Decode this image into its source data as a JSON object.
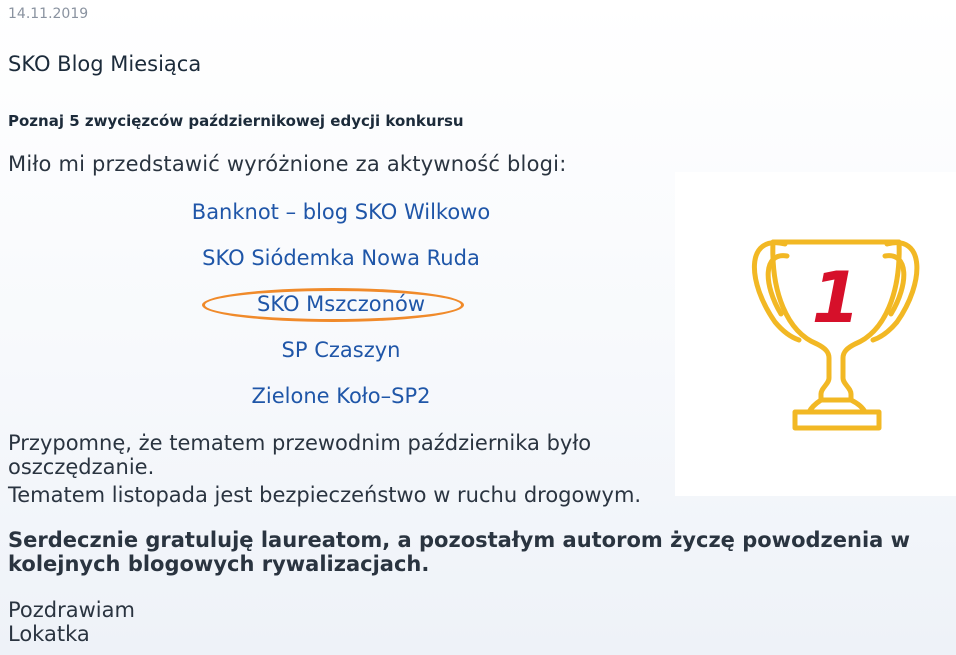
{
  "post": {
    "date": "14.11.2019",
    "title": "SKO Blog Miesiąca",
    "subtitle": "Poznaj 5 zwycięzców październikowej edycji konkursu",
    "intro": "Miło mi przedstawić wyróżnione za aktywność blogi:"
  },
  "winners": [
    {
      "label": "Banknot – blog SKO Wilkowo"
    },
    {
      "label": "SKO Siódemka Nowa Ruda"
    },
    {
      "label": "SKO Mszczonów"
    },
    {
      "label": "SP Czaszyn"
    },
    {
      "label": "Zielone Koło–SP2"
    }
  ],
  "trophy": {
    "number": "1"
  },
  "body": {
    "reminder": "Przypomnę, że tematem przewodnim października było oszczędzanie.",
    "november_topic": "Tematem listopada jest bezpieczeństwo w ruchu drogowym.",
    "congrats": "Serdecznie gratuluję laureatom, a pozostałym autorom życzę powodzenia w kolejnych blogowych rywalizacjach.",
    "greeting": "Pozdrawiam",
    "signature": "Lokatka"
  },
  "colors": {
    "link": "#1f56a8",
    "highlight": "#f08a2a",
    "trophy": "#f2b824",
    "number": "#d6102a"
  }
}
